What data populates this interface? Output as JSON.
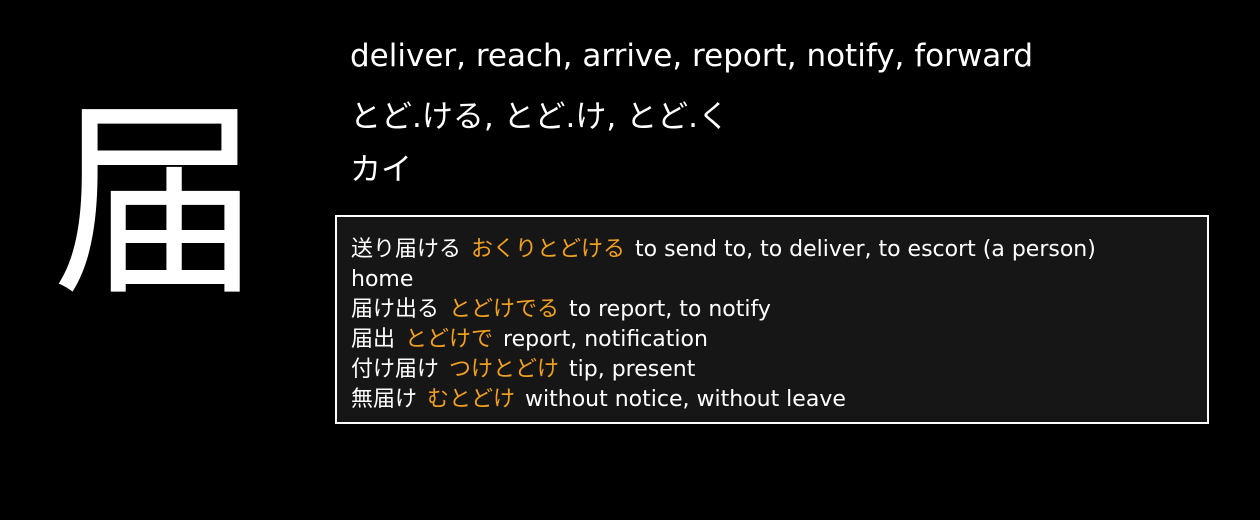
{
  "colors": {
    "background": "#000000",
    "text": "#ffffff",
    "reading": "#f0a020",
    "panel_bg": "#161616",
    "panel_border": "#ffffff"
  },
  "kanji": {
    "character": "届"
  },
  "meanings": "deliver, reach, arrive, report, notify, forward",
  "kun_readings": "とど.ける, とど.け, とど.く",
  "on_readings": "カイ",
  "examples": [
    {
      "word": "送り届ける",
      "reading": "おくりとどける",
      "gloss": "to send to, to deliver, to escort (a person)",
      "gloss_cont": "home"
    },
    {
      "word": "届け出る",
      "reading": "とどけでる",
      "gloss": "to report, to notify"
    },
    {
      "word": "届出",
      "reading": "とどけで",
      "gloss": "report, notification"
    },
    {
      "word": "付け届け",
      "reading": "つけとどけ",
      "gloss": "tip, present"
    },
    {
      "word": "無届け",
      "reading": "むとどけ",
      "gloss": "without notice, without leave"
    }
  ]
}
